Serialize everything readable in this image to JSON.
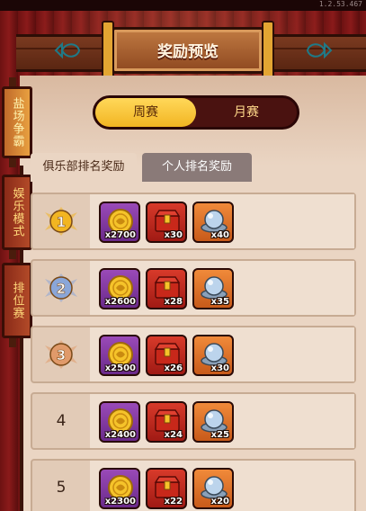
{
  "version_text": "1.2.53.467",
  "header": {
    "title": "奖励预览"
  },
  "side_tabs": [
    {
      "label": "盐场争霸",
      "active": true
    },
    {
      "label": "娱乐模式",
      "active": false
    },
    {
      "label": "排位赛",
      "active": false
    }
  ],
  "toggle": {
    "week_label": "周赛",
    "month_label": "月赛",
    "selected": "周赛"
  },
  "tabs": {
    "club_label": "俱乐部排名奖励",
    "person_label": "个人排名奖励",
    "selected": "俱乐部排名奖励"
  },
  "rows": [
    {
      "rank": "1",
      "coin_qty": "x2700",
      "chest_qty": "x30",
      "orb_qty": "x40"
    },
    {
      "rank": "2",
      "coin_qty": "x2600",
      "chest_qty": "x28",
      "orb_qty": "x35"
    },
    {
      "rank": "3",
      "coin_qty": "x2500",
      "chest_qty": "x26",
      "orb_qty": "x30"
    },
    {
      "rank": "4",
      "coin_qty": "x2400",
      "chest_qty": "x24",
      "orb_qty": "x25"
    },
    {
      "rank": "5",
      "coin_qty": "x2300",
      "chest_qty": "x22",
      "orb_qty": "x20"
    }
  ],
  "colors": {
    "gold": "#f2b522",
    "silver": "#8aa6d8",
    "bronze": "#e09a6a",
    "accent_red": "#8a1a1a"
  }
}
